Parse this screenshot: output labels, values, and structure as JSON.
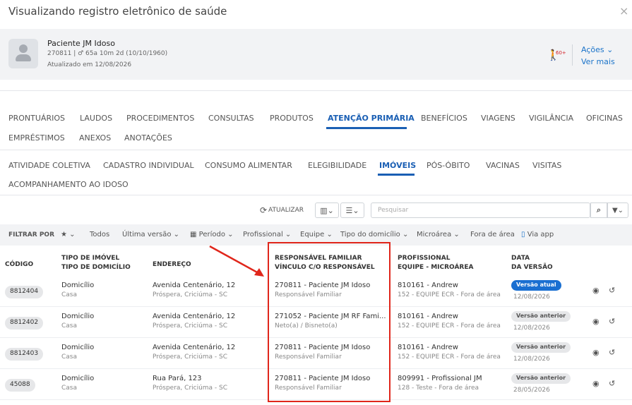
{
  "window": {
    "title": "Visualizando registro eletrônico de saúde",
    "close_symbol": "×"
  },
  "patient": {
    "name": "Paciente JM Idoso",
    "info": "270811 | ♂ 65a 10m 2d (10/10/1960)",
    "updated": "Atualizado em 12/08/2026",
    "elder_badge": "60+",
    "actions_label": "Ações ⌄",
    "more_label": "Ver mais"
  },
  "main_tabs": [
    "PRONTUÁRIOS",
    "LAUDOS",
    "PROCEDIMENTOS",
    "CONSULTAS",
    "PRODUTOS",
    "ATENÇÃO PRIMÁRIA",
    "BENEFÍCIOS",
    "VIAGENS",
    "VIGILÂNCIA",
    "OFICINAS",
    "EMPRÉSTIMOS",
    "ANEXOS",
    "ANOTAÇÕES"
  ],
  "sub_tabs": [
    "ATIVIDADE COLETIVA",
    "CADASTRO INDIVIDUAL",
    "CONSUMO ALIMENTAR",
    "ELEGIBILIDADE",
    "IMÓVEIS",
    "PÓS-ÓBITO",
    "VACINAS",
    "VISITAS",
    "ACOMPANHAMENTO AO IDOSO"
  ],
  "toolbar": {
    "refresh_label": "ATUALIZAR",
    "search_placeholder": "Pesquisar"
  },
  "filters": {
    "label": "FILTRAR POR",
    "todos": "Todos",
    "ultima": "Última versão ⌄",
    "periodo": "Período ⌄",
    "profissional": "Profissional ⌄",
    "equipe": "Equipe ⌄",
    "tipo": "Tipo do domicílio ⌄",
    "microarea": "Microárea ⌄",
    "fora": "Fora de área",
    "app": "Via app"
  },
  "table": {
    "headers": {
      "codigo": "CÓDIGO",
      "tipo1": "TIPO DE IMÓVEL",
      "tipo2": "TIPO DE DOMICÍLIO",
      "endereco": "ENDEREÇO",
      "resp1": "RESPONSÁVEL FAMILIAR",
      "resp2": "VÍNCULO C/O RESPONSÁVEL",
      "prof1": "PROFISSIONAL",
      "prof2": "EQUIPE - MICROÁREA",
      "data1": "DATA",
      "data2": "DA VERSÃO"
    },
    "rows": [
      {
        "code": "8812404",
        "tipo": "Domicílio",
        "sub": "Casa",
        "end": "Avenida Centenário, 12",
        "cidade": "Próspera, Criciúma - SC",
        "resp": "270811 - Paciente JM Idoso",
        "vinc": "Responsável Familiar",
        "prof": "810161 - Andrew",
        "equipe": "152 - EQUIPE ECR - Fora de área",
        "versao": "Versão atual",
        "data": "12/08/2026"
      },
      {
        "code": "8812402",
        "tipo": "Domicílio",
        "sub": "Casa",
        "end": "Avenida Centenário, 12",
        "cidade": "Próspera, Criciúma - SC",
        "resp": "271052 - Paciente JM RF Fami...",
        "vinc": "Neto(a) / Bisneto(a)",
        "prof": "810161 - Andrew",
        "equipe": "152 - EQUIPE ECR - Fora de área",
        "versao": "Versão anterior",
        "data": "12/08/2026"
      },
      {
        "code": "8812403",
        "tipo": "Domicílio",
        "sub": "Casa",
        "end": "Avenida Centenário, 12",
        "cidade": "Próspera, Criciúma - SC",
        "resp": "270811 - Paciente JM Idoso",
        "vinc": "Responsável Familiar",
        "prof": "810161 - Andrew",
        "equipe": "152 - EQUIPE ECR - Fora de área",
        "versao": "Versão anterior",
        "data": "12/08/2026"
      },
      {
        "code": "45088",
        "tipo": "Domicílio",
        "sub": "Casa",
        "end": "Rua Pará, 123",
        "cidade": "Próspera, Criciúma - SC",
        "resp": "270811 - Paciente JM Idoso",
        "vinc": "Responsável Familiar",
        "prof": "809991 - Profissional JM",
        "equipe": "128 - Teste - Fora de área",
        "versao": "Versão anterior",
        "data": "28/05/2026"
      }
    ]
  },
  "colors": {
    "accent": "#1a5fb4",
    "highlight": "#e0261b",
    "elder": "#d21f26"
  }
}
